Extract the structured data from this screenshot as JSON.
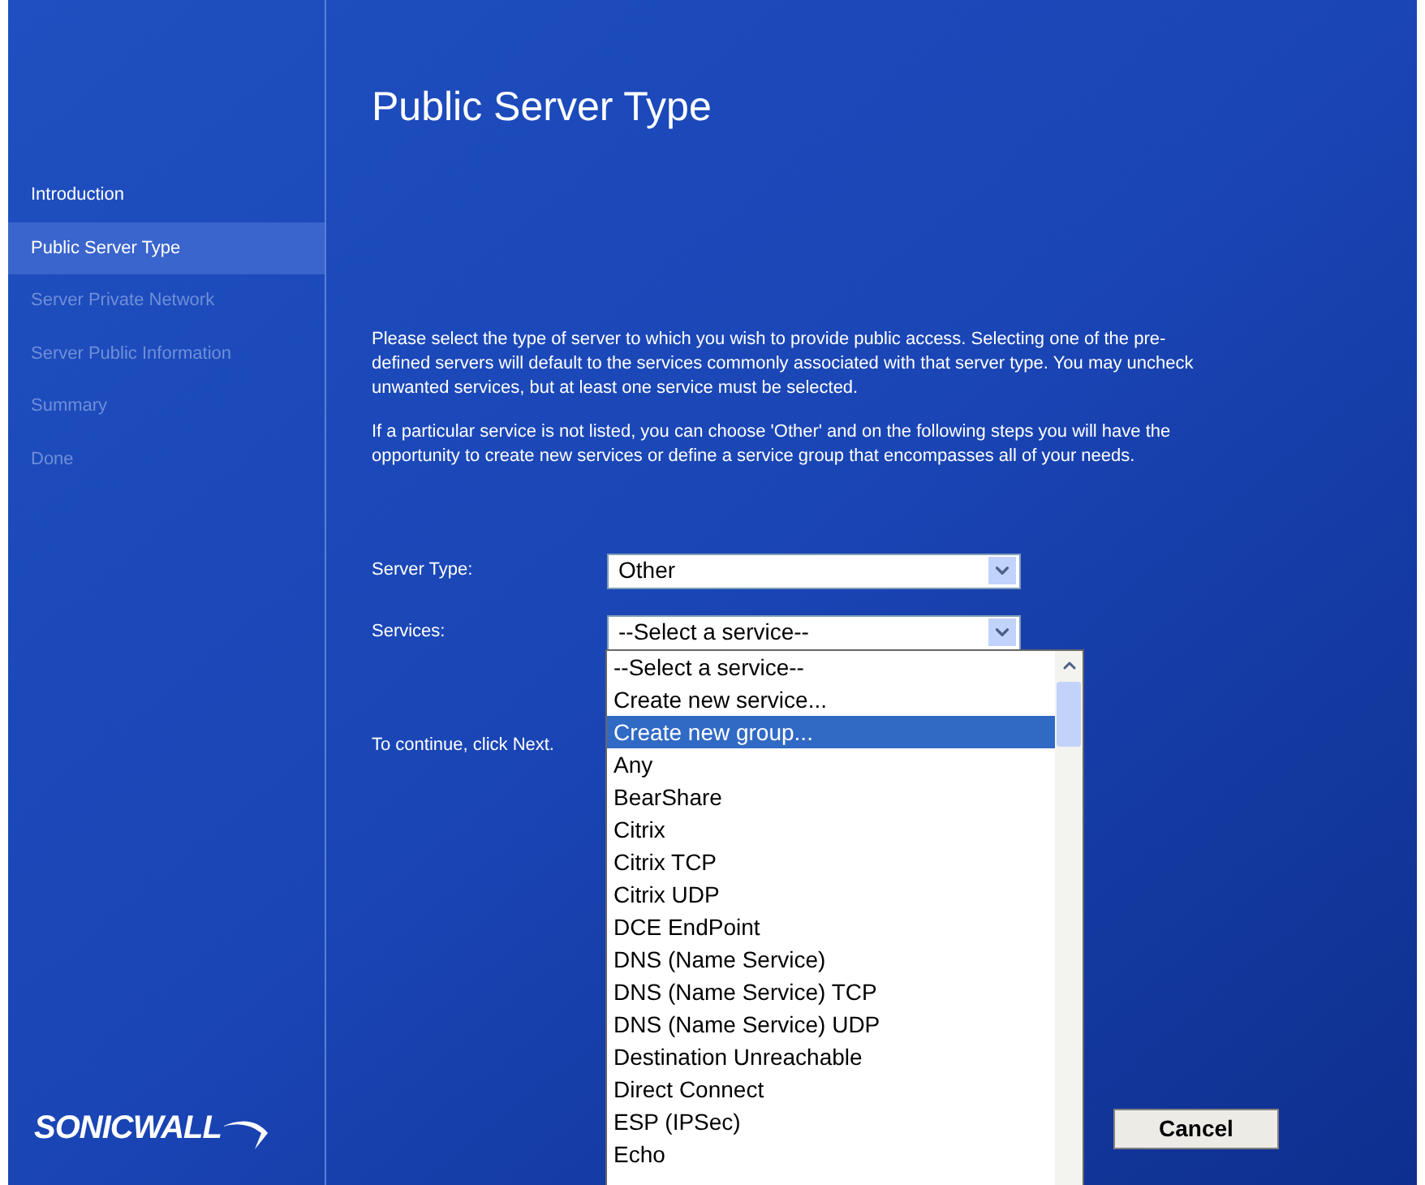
{
  "sidebar": {
    "items": [
      {
        "label": "Introduction",
        "selected": false,
        "disabled": false
      },
      {
        "label": "Public Server Type",
        "selected": true,
        "disabled": false
      },
      {
        "label": "Server Private Network",
        "selected": false,
        "disabled": true
      },
      {
        "label": "Server Public Information",
        "selected": false,
        "disabled": true
      },
      {
        "label": "Summary",
        "selected": false,
        "disabled": true
      },
      {
        "label": "Done",
        "selected": false,
        "disabled": true
      }
    ],
    "logo": "SONICWALL"
  },
  "title": "Public Server Type",
  "paragraphs": [
    "Please select the type of server to which you wish to provide public access. Selecting one of the pre-defined servers will default to the services commonly associated with that server type. You may uncheck unwanted services, but at least one service must be selected.",
    "If a particular service is not listed, you can choose 'Other' and on the following steps you will have the opportunity to create new services or define a service group that encompasses all of your needs."
  ],
  "fields": [
    {
      "label": "Server Type:",
      "value": "Other"
    },
    {
      "label": "Services:",
      "value": "--Select a service--"
    }
  ],
  "hint": "To continue, click Next.",
  "dropdown": {
    "options": [
      {
        "label": "--Select a service--",
        "selected": false
      },
      {
        "label": "Create new service...",
        "selected": false
      },
      {
        "label": "Create new group...",
        "selected": true
      },
      {
        "label": "Any",
        "selected": false
      },
      {
        "label": "BearShare",
        "selected": false
      },
      {
        "label": "Citrix",
        "selected": false
      },
      {
        "label": "Citrix TCP",
        "selected": false
      },
      {
        "label": "Citrix UDP",
        "selected": false
      },
      {
        "label": "DCE EndPoint",
        "selected": false
      },
      {
        "label": "DNS (Name Service)",
        "selected": false
      },
      {
        "label": "DNS (Name Service) TCP",
        "selected": false
      },
      {
        "label": "DNS (Name Service) UDP",
        "selected": false
      },
      {
        "label": "Destination Unreachable",
        "selected": false
      },
      {
        "label": "Direct Connect",
        "selected": false
      },
      {
        "label": "ESP (IPSec)",
        "selected": false
      },
      {
        "label": "Echo",
        "selected": false
      }
    ]
  },
  "buttons": [
    {
      "label": "Cancel"
    }
  ]
}
